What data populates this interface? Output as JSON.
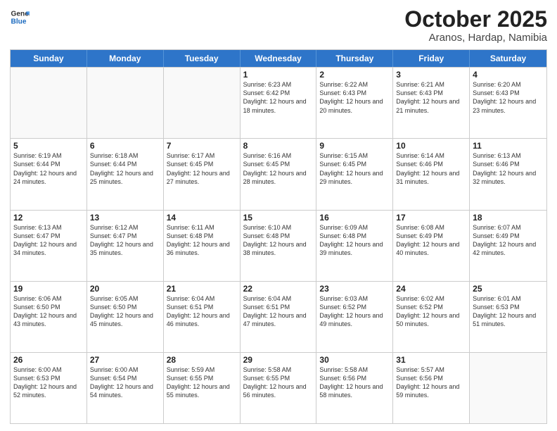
{
  "header": {
    "logo_line1": "General",
    "logo_line2": "Blue",
    "month": "October 2025",
    "location": "Aranos, Hardap, Namibia"
  },
  "weekdays": [
    "Sunday",
    "Monday",
    "Tuesday",
    "Wednesday",
    "Thursday",
    "Friday",
    "Saturday"
  ],
  "rows": [
    [
      {
        "day": "",
        "info": ""
      },
      {
        "day": "",
        "info": ""
      },
      {
        "day": "",
        "info": ""
      },
      {
        "day": "1",
        "info": "Sunrise: 6:23 AM\nSunset: 6:42 PM\nDaylight: 12 hours and 18 minutes."
      },
      {
        "day": "2",
        "info": "Sunrise: 6:22 AM\nSunset: 6:43 PM\nDaylight: 12 hours and 20 minutes."
      },
      {
        "day": "3",
        "info": "Sunrise: 6:21 AM\nSunset: 6:43 PM\nDaylight: 12 hours and 21 minutes."
      },
      {
        "day": "4",
        "info": "Sunrise: 6:20 AM\nSunset: 6:43 PM\nDaylight: 12 hours and 23 minutes."
      }
    ],
    [
      {
        "day": "5",
        "info": "Sunrise: 6:19 AM\nSunset: 6:44 PM\nDaylight: 12 hours and 24 minutes."
      },
      {
        "day": "6",
        "info": "Sunrise: 6:18 AM\nSunset: 6:44 PM\nDaylight: 12 hours and 25 minutes."
      },
      {
        "day": "7",
        "info": "Sunrise: 6:17 AM\nSunset: 6:45 PM\nDaylight: 12 hours and 27 minutes."
      },
      {
        "day": "8",
        "info": "Sunrise: 6:16 AM\nSunset: 6:45 PM\nDaylight: 12 hours and 28 minutes."
      },
      {
        "day": "9",
        "info": "Sunrise: 6:15 AM\nSunset: 6:45 PM\nDaylight: 12 hours and 29 minutes."
      },
      {
        "day": "10",
        "info": "Sunrise: 6:14 AM\nSunset: 6:46 PM\nDaylight: 12 hours and 31 minutes."
      },
      {
        "day": "11",
        "info": "Sunrise: 6:13 AM\nSunset: 6:46 PM\nDaylight: 12 hours and 32 minutes."
      }
    ],
    [
      {
        "day": "12",
        "info": "Sunrise: 6:13 AM\nSunset: 6:47 PM\nDaylight: 12 hours and 34 minutes."
      },
      {
        "day": "13",
        "info": "Sunrise: 6:12 AM\nSunset: 6:47 PM\nDaylight: 12 hours and 35 minutes."
      },
      {
        "day": "14",
        "info": "Sunrise: 6:11 AM\nSunset: 6:48 PM\nDaylight: 12 hours and 36 minutes."
      },
      {
        "day": "15",
        "info": "Sunrise: 6:10 AM\nSunset: 6:48 PM\nDaylight: 12 hours and 38 minutes."
      },
      {
        "day": "16",
        "info": "Sunrise: 6:09 AM\nSunset: 6:48 PM\nDaylight: 12 hours and 39 minutes."
      },
      {
        "day": "17",
        "info": "Sunrise: 6:08 AM\nSunset: 6:49 PM\nDaylight: 12 hours and 40 minutes."
      },
      {
        "day": "18",
        "info": "Sunrise: 6:07 AM\nSunset: 6:49 PM\nDaylight: 12 hours and 42 minutes."
      }
    ],
    [
      {
        "day": "19",
        "info": "Sunrise: 6:06 AM\nSunset: 6:50 PM\nDaylight: 12 hours and 43 minutes."
      },
      {
        "day": "20",
        "info": "Sunrise: 6:05 AM\nSunset: 6:50 PM\nDaylight: 12 hours and 45 minutes."
      },
      {
        "day": "21",
        "info": "Sunrise: 6:04 AM\nSunset: 6:51 PM\nDaylight: 12 hours and 46 minutes."
      },
      {
        "day": "22",
        "info": "Sunrise: 6:04 AM\nSunset: 6:51 PM\nDaylight: 12 hours and 47 minutes."
      },
      {
        "day": "23",
        "info": "Sunrise: 6:03 AM\nSunset: 6:52 PM\nDaylight: 12 hours and 49 minutes."
      },
      {
        "day": "24",
        "info": "Sunrise: 6:02 AM\nSunset: 6:52 PM\nDaylight: 12 hours and 50 minutes."
      },
      {
        "day": "25",
        "info": "Sunrise: 6:01 AM\nSunset: 6:53 PM\nDaylight: 12 hours and 51 minutes."
      }
    ],
    [
      {
        "day": "26",
        "info": "Sunrise: 6:00 AM\nSunset: 6:53 PM\nDaylight: 12 hours and 52 minutes."
      },
      {
        "day": "27",
        "info": "Sunrise: 6:00 AM\nSunset: 6:54 PM\nDaylight: 12 hours and 54 minutes."
      },
      {
        "day": "28",
        "info": "Sunrise: 5:59 AM\nSunset: 6:55 PM\nDaylight: 12 hours and 55 minutes."
      },
      {
        "day": "29",
        "info": "Sunrise: 5:58 AM\nSunset: 6:55 PM\nDaylight: 12 hours and 56 minutes."
      },
      {
        "day": "30",
        "info": "Sunrise: 5:58 AM\nSunset: 6:56 PM\nDaylight: 12 hours and 58 minutes."
      },
      {
        "day": "31",
        "info": "Sunrise: 5:57 AM\nSunset: 6:56 PM\nDaylight: 12 hours and 59 minutes."
      },
      {
        "day": "",
        "info": ""
      }
    ]
  ]
}
